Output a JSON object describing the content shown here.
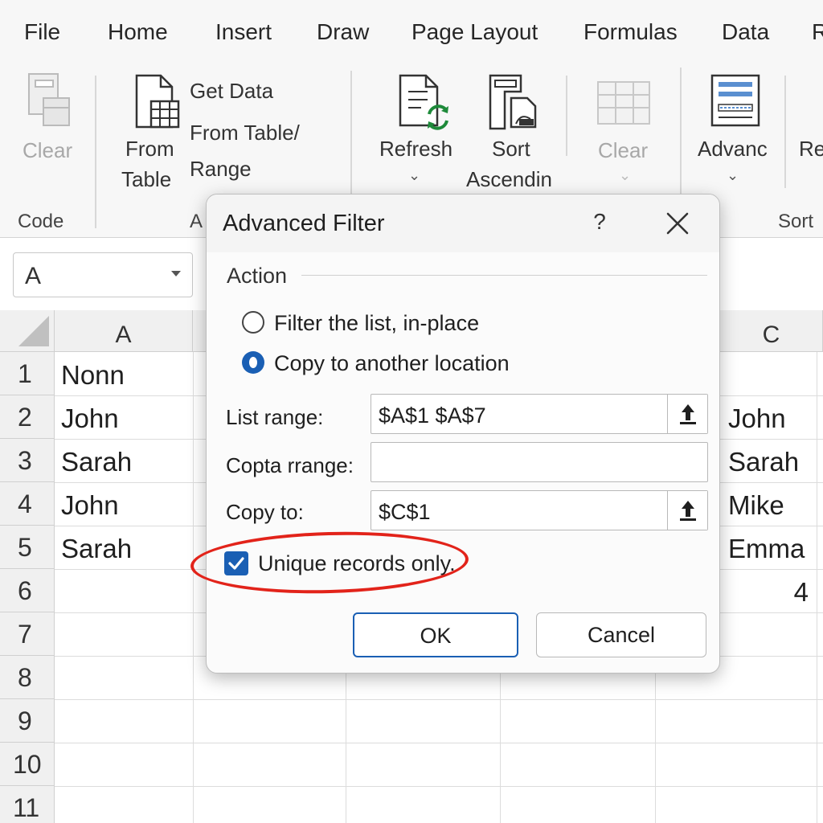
{
  "ribbon": {
    "tabs": [
      "File",
      "Home",
      "Insert",
      "Draw",
      "Page Layout",
      "Formulas",
      "Data",
      "R"
    ],
    "clear_left_label": "Clear",
    "from_table_line1": "From",
    "from_table_line2": "Table",
    "get_data_label": "Get Data",
    "from_range_line1": "From Table/",
    "from_range_line2": "Range",
    "refresh_label": "Refresh",
    "sort_line1": "Sort",
    "sort_line2": "Ascendin",
    "clear_right_label": "Clear",
    "advanced_label": "Advanc",
    "re_label": "Re",
    "groups": {
      "code": "Code",
      "get_transform": "A",
      "sort": "Sort"
    }
  },
  "name_box": {
    "value": "A"
  },
  "grid": {
    "columns": [
      "A",
      "C"
    ],
    "rows": [
      "1",
      "2",
      "3",
      "4",
      "5",
      "6",
      "7",
      "8",
      "9",
      "10",
      "11"
    ],
    "column_a": [
      "Nonn",
      "John",
      "Sarah",
      "John",
      "Sarah"
    ],
    "column_c": [
      "John",
      "Sarah",
      "Mike",
      "Emma",
      "4"
    ]
  },
  "dialog": {
    "title": "Advanced Filter",
    "help": "?",
    "section": "Action",
    "option_filter": "Filter the list, in-place",
    "option_copy": "Copy to another location",
    "list_range_label": "List range:",
    "list_range_value": "$A$1 $A$7",
    "criteria_label": "Copta rrange:",
    "criteria_value": "",
    "copy_to_label": "Copy to:",
    "copy_to_value": "$C$1",
    "unique_label": "Unique records only.",
    "ok_label": "OK",
    "cancel_label": "Cancel"
  },
  "colors": {
    "accent": "#1a5fb4",
    "annotation": "#e2231a",
    "refresh_green": "#1e8a3a"
  }
}
